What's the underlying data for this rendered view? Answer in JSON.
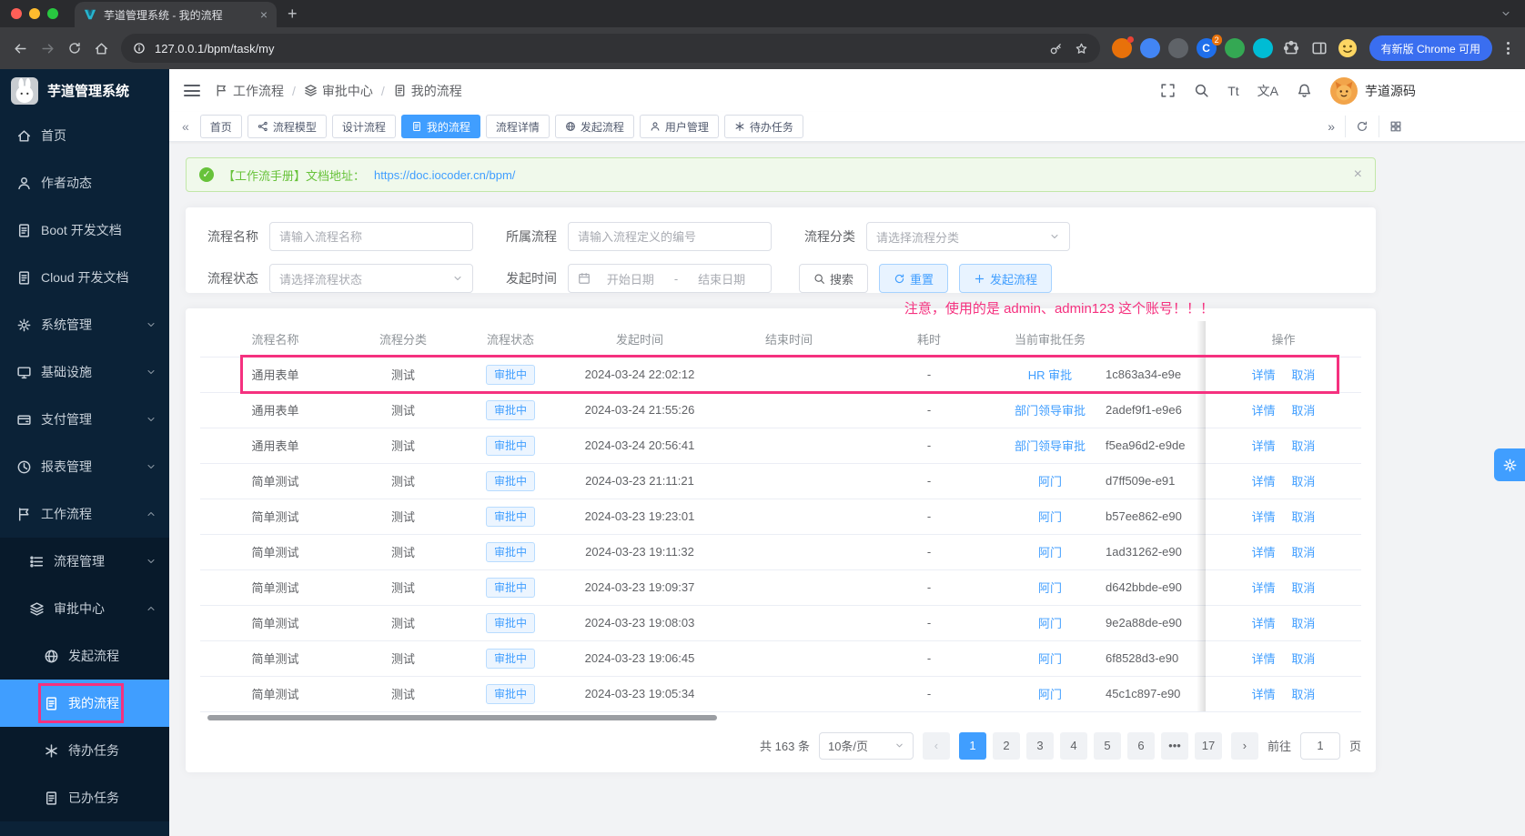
{
  "browser": {
    "tab_title": "芋道管理系统 - 我的流程",
    "url": "127.0.0.1/bpm/task/my",
    "update_button": "有新版 Chrome 可用",
    "extension_badge": "2",
    "extension_letter": "C"
  },
  "sidebar": {
    "title": "芋道管理系统",
    "items": [
      {
        "name": "home",
        "label": "首页",
        "icon": "home-icon",
        "level": 0
      },
      {
        "name": "author-news",
        "label": "作者动态",
        "icon": "user-icon",
        "level": 0
      },
      {
        "name": "boot-docs",
        "label": "Boot 开发文档",
        "icon": "doc-icon",
        "level": 0
      },
      {
        "name": "cloud-docs",
        "label": "Cloud 开发文档",
        "icon": "doc-icon",
        "level": 0
      },
      {
        "name": "system-mgmt",
        "label": "系统管理",
        "icon": "gear-icon",
        "level": 0,
        "chevron": "down"
      },
      {
        "name": "infrastructure",
        "label": "基础设施",
        "icon": "monitor-icon",
        "level": 0,
        "chevron": "down"
      },
      {
        "name": "pay-mgmt",
        "label": "支付管理",
        "icon": "wallet-icon",
        "level": 0,
        "chevron": "down"
      },
      {
        "name": "report-mgmt",
        "label": "报表管理",
        "icon": "chart-icon",
        "level": 0,
        "chevron": "down"
      },
      {
        "name": "workflow",
        "label": "工作流程",
        "icon": "flow-icon",
        "level": 0,
        "chevron": "up"
      },
      {
        "name": "process-mgmt",
        "label": "流程管理",
        "icon": "list-icon",
        "level": 1,
        "sub": true,
        "chevron": "down"
      },
      {
        "name": "approval-center",
        "label": "审批中心",
        "icon": "stack-icon",
        "level": 1,
        "sub": true,
        "chevron": "up"
      },
      {
        "name": "start-process",
        "label": "发起流程",
        "icon": "globe-icon",
        "level": 2,
        "sub": true
      },
      {
        "name": "my-process",
        "label": "我的流程",
        "icon": "doc-icon",
        "level": 2,
        "sub": true,
        "active": true,
        "annotated": true
      },
      {
        "name": "todo-task",
        "label": "待办任务",
        "icon": "cog-icon",
        "level": 2,
        "sub": true
      },
      {
        "name": "done-task",
        "label": "已办任务",
        "icon": "doc-icon",
        "level": 2,
        "sub": true
      }
    ]
  },
  "navbar": {
    "breadcrumb": [
      {
        "label": "工作流程",
        "icon": "flow-icon"
      },
      {
        "label": "审批中心",
        "icon": "stack-icon"
      },
      {
        "label": "我的流程",
        "icon": "doc-icon"
      }
    ],
    "fontsize_tool": "Tt",
    "translate_tool": "文A",
    "username": "芋道源码"
  },
  "tabbar": {
    "scroll_left": "«",
    "scroll_right": "»",
    "tabs": [
      {
        "name": "home",
        "label": "首页"
      },
      {
        "name": "process-model",
        "label": "流程模型",
        "icon": "model-icon"
      },
      {
        "name": "design-process",
        "label": "设计流程"
      },
      {
        "name": "my-process",
        "label": "我的流程",
        "icon": "doc-icon",
        "active": true
      },
      {
        "name": "process-detail",
        "label": "流程详情"
      },
      {
        "name": "start-process",
        "label": "发起流程",
        "icon": "globe-icon"
      },
      {
        "name": "user-mgmt",
        "label": "用户管理",
        "icon": "user-icon"
      },
      {
        "name": "todo-task",
        "label": "待办任务",
        "icon": "cog-icon"
      }
    ]
  },
  "notice": {
    "text": "【工作流手册】文档地址：",
    "link": "https://doc.iocoder.cn/bpm/",
    "close": "×"
  },
  "filters": {
    "name_label": "流程名称",
    "name_placeholder": "请输入流程名称",
    "definition_label": "所属流程",
    "definition_placeholder": "请输入流程定义的编号",
    "category_label": "流程分类",
    "category_placeholder": "请选择流程分类",
    "status_label": "流程状态",
    "status_placeholder": "请选择流程状态",
    "time_label": "发起时间",
    "start_placeholder": "开始日期",
    "range_separator": "-",
    "end_placeholder": "结束日期",
    "search_button": "搜索",
    "reset_button": "重置",
    "create_button": "发起流程"
  },
  "annotation": "注意，使用的是 admin、admin123 这个账号！！！",
  "table": {
    "headers": {
      "name": "流程名称",
      "category": "流程分类",
      "status": "流程状态",
      "start": "发起时间",
      "end": "结束时间",
      "duration": "耗时",
      "task": "当前审批任务",
      "pid": "",
      "action": "操作"
    },
    "action_detail": "详情",
    "action_cancel": "取消",
    "rows": [
      {
        "name": "通用表单",
        "category": "测试",
        "status": "审批中",
        "start": "2024-03-24 22:02:12",
        "end": "",
        "duration": "-",
        "task": "HR 审批",
        "pid": "1c863a34-e9e"
      },
      {
        "name": "通用表单",
        "category": "测试",
        "status": "审批中",
        "start": "2024-03-24 21:55:26",
        "end": "",
        "duration": "-",
        "task": "部门领导审批",
        "pid": "2adef9f1-e9e6"
      },
      {
        "name": "通用表单",
        "category": "测试",
        "status": "审批中",
        "start": "2024-03-24 20:56:41",
        "end": "",
        "duration": "-",
        "task": "部门领导审批",
        "pid": "f5ea96d2-e9de"
      },
      {
        "name": "简单测试",
        "category": "测试",
        "status": "审批中",
        "start": "2024-03-23 21:11:21",
        "end": "",
        "duration": "-",
        "task": "阿门",
        "pid": "d7ff509e-e91"
      },
      {
        "name": "简单测试",
        "category": "测试",
        "status": "审批中",
        "start": "2024-03-23 19:23:01",
        "end": "",
        "duration": "-",
        "task": "阿门",
        "pid": "b57ee862-e90"
      },
      {
        "name": "简单测试",
        "category": "测试",
        "status": "审批中",
        "start": "2024-03-23 19:11:32",
        "end": "",
        "duration": "-",
        "task": "阿门",
        "pid": "1ad31262-e90"
      },
      {
        "name": "简单测试",
        "category": "测试",
        "status": "审批中",
        "start": "2024-03-23 19:09:37",
        "end": "",
        "duration": "-",
        "task": "阿门",
        "pid": "d642bbde-e90"
      },
      {
        "name": "简单测试",
        "category": "测试",
        "status": "审批中",
        "start": "2024-03-23 19:08:03",
        "end": "",
        "duration": "-",
        "task": "阿门",
        "pid": "9e2a88de-e90"
      },
      {
        "name": "简单测试",
        "category": "测试",
        "status": "审批中",
        "start": "2024-03-23 19:06:45",
        "end": "",
        "duration": "-",
        "task": "阿门",
        "pid": "6f8528d3-e90"
      },
      {
        "name": "简单测试",
        "category": "测试",
        "status": "审批中",
        "start": "2024-03-23 19:05:34",
        "end": "",
        "duration": "-",
        "task": "阿门",
        "pid": "45c1c897-e90"
      }
    ]
  },
  "pagination": {
    "total": "共 163 条",
    "page_size": "10条/页",
    "prev": "‹",
    "next": "›",
    "pages": [
      {
        "label": "1",
        "active": true
      },
      {
        "label": "2"
      },
      {
        "label": "3"
      },
      {
        "label": "4"
      },
      {
        "label": "5"
      },
      {
        "label": "6"
      },
      {
        "label": "•••",
        "ellipsis": true
      },
      {
        "label": "17"
      }
    ],
    "goto_label": "前往",
    "goto_value": "1",
    "goto_unit": "页"
  }
}
